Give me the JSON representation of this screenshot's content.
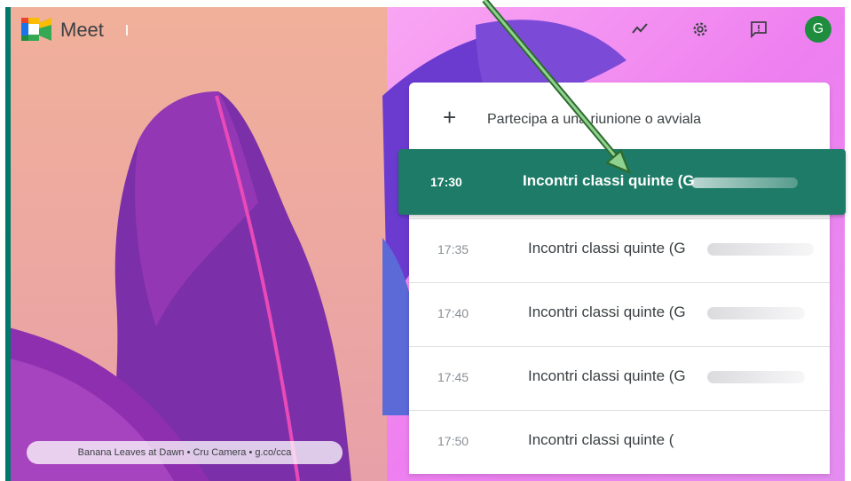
{
  "header": {
    "app_name": "Meet",
    "avatar_letter": "G",
    "icons": [
      "activity-chart-icon",
      "gear-icon",
      "feedback-icon"
    ]
  },
  "menu": {
    "join_icon": "plus-icon",
    "join_label": "Partecipa a una riunione o avviala",
    "meetings": [
      {
        "time": "17:30",
        "title": "Incontri classi quinte (G"
      },
      {
        "time": "17:35",
        "title": "Incontri classi quinte (G"
      },
      {
        "time": "17:40",
        "title": "Incontri classi quinte (G"
      },
      {
        "time": "17:45",
        "title": "Incontri classi quinte (G"
      },
      {
        "time": "17:50",
        "title": "Incontri classi quinte ("
      }
    ]
  },
  "background_caption": "Banana Leaves at Dawn  •  Cru Camera  •  g.co/cca",
  "colors": {
    "accent": "#1e7b67",
    "avatar": "#1e8e3e",
    "left_strip": "#00796b"
  }
}
